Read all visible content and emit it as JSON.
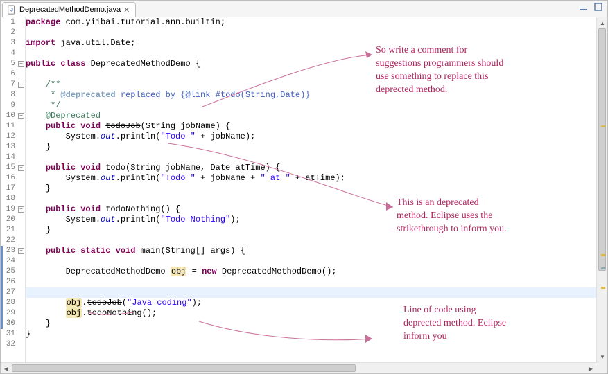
{
  "tab": {
    "filename": "DeprecatedMethodDemo.java",
    "close_glyph": "✕"
  },
  "code": {
    "highlight_line": 27,
    "lines": [
      {
        "n": 1,
        "fold": "",
        "mod": false,
        "tokens": [
          [
            "kw",
            "package"
          ],
          [
            "pkg",
            " com.yiibai.tutorial.ann.builtin;"
          ]
        ]
      },
      {
        "n": 2,
        "fold": "",
        "mod": false,
        "tokens": []
      },
      {
        "n": 3,
        "fold": "",
        "mod": false,
        "tokens": [
          [
            "kw",
            "import"
          ],
          [
            "pkg",
            " java.util.Date;"
          ]
        ]
      },
      {
        "n": 4,
        "fold": "",
        "mod": false,
        "tokens": []
      },
      {
        "n": 5,
        "fold": "-",
        "mod": false,
        "tokens": [
          [
            "kw",
            "public class"
          ],
          [
            "pkg",
            " DeprecatedMethodDemo {"
          ]
        ]
      },
      {
        "n": 6,
        "fold": "",
        "mod": false,
        "tokens": []
      },
      {
        "n": 7,
        "fold": "-",
        "mod": false,
        "tokens": [
          [
            "pkg",
            "    "
          ],
          [
            "com",
            "/**"
          ]
        ]
      },
      {
        "n": 8,
        "fold": "",
        "mod": false,
        "tokens": [
          [
            "pkg",
            "    "
          ],
          [
            "com",
            " * "
          ],
          [
            "jtag",
            "@deprecated"
          ],
          [
            "jlink",
            " replaced by {@link #todo(String,Date)}"
          ]
        ]
      },
      {
        "n": 9,
        "fold": "",
        "mod": false,
        "tokens": [
          [
            "pkg",
            "    "
          ],
          [
            "com",
            " */"
          ]
        ]
      },
      {
        "n": 10,
        "fold": "-",
        "mod": false,
        "tokens": [
          [
            "pkg",
            "    "
          ],
          [
            "com",
            "@Deprecated"
          ]
        ]
      },
      {
        "n": 11,
        "fold": "",
        "mod": false,
        "tokens": [
          [
            "pkg",
            "    "
          ],
          [
            "kw",
            "public void"
          ],
          [
            "pkg",
            " "
          ],
          [
            "strike",
            "todoJob"
          ],
          [
            "pkg",
            "(String jobName) {"
          ]
        ]
      },
      {
        "n": 12,
        "fold": "",
        "mod": false,
        "tokens": [
          [
            "pkg",
            "        System."
          ],
          [
            "fld",
            "out"
          ],
          [
            "pkg",
            ".println("
          ],
          [
            "str",
            "\"Todo \""
          ],
          [
            "pkg",
            " + jobName);"
          ]
        ]
      },
      {
        "n": 13,
        "fold": "",
        "mod": false,
        "tokens": [
          [
            "pkg",
            "    }"
          ]
        ]
      },
      {
        "n": 14,
        "fold": "",
        "mod": false,
        "tokens": []
      },
      {
        "n": 15,
        "fold": "-",
        "mod": false,
        "tokens": [
          [
            "pkg",
            "    "
          ],
          [
            "kw",
            "public void"
          ],
          [
            "pkg",
            " todo(String jobName, Date atTime) {"
          ]
        ]
      },
      {
        "n": 16,
        "fold": "",
        "mod": false,
        "tokens": [
          [
            "pkg",
            "        System."
          ],
          [
            "fld",
            "out"
          ],
          [
            "pkg",
            ".println("
          ],
          [
            "str",
            "\"Todo \""
          ],
          [
            "pkg",
            " + jobName + "
          ],
          [
            "str",
            "\" at \""
          ],
          [
            "pkg",
            " + atTime);"
          ]
        ]
      },
      {
        "n": 17,
        "fold": "",
        "mod": false,
        "tokens": [
          [
            "pkg",
            "    }"
          ]
        ]
      },
      {
        "n": 18,
        "fold": "",
        "mod": false,
        "tokens": []
      },
      {
        "n": 19,
        "fold": "-",
        "mod": false,
        "tokens": [
          [
            "pkg",
            "    "
          ],
          [
            "kw",
            "public void"
          ],
          [
            "pkg",
            " todoNothing() {"
          ]
        ]
      },
      {
        "n": 20,
        "fold": "",
        "mod": false,
        "tokens": [
          [
            "pkg",
            "        System."
          ],
          [
            "fld",
            "out"
          ],
          [
            "pkg",
            ".println("
          ],
          [
            "str",
            "\"Todo Nothing\""
          ],
          [
            "pkg",
            ");"
          ]
        ]
      },
      {
        "n": 21,
        "fold": "",
        "mod": false,
        "tokens": [
          [
            "pkg",
            "    }"
          ]
        ]
      },
      {
        "n": 22,
        "fold": "",
        "mod": false,
        "tokens": []
      },
      {
        "n": 23,
        "fold": "-",
        "mod": true,
        "tokens": [
          [
            "pkg",
            "    "
          ],
          [
            "kw",
            "public static void"
          ],
          [
            "pkg",
            " main(String[] args) {"
          ]
        ]
      },
      {
        "n": 24,
        "fold": "",
        "mod": true,
        "tokens": []
      },
      {
        "n": 25,
        "fold": "",
        "mod": true,
        "tokens": [
          [
            "pkg",
            "        DeprecatedMethodDemo "
          ],
          [
            "warn",
            "obj"
          ],
          [
            "pkg",
            " = "
          ],
          [
            "kw",
            "new"
          ],
          [
            "pkg",
            " DeprecatedMethodDemo();"
          ]
        ]
      },
      {
        "n": 26,
        "fold": "",
        "mod": true,
        "tokens": []
      },
      {
        "n": 27,
        "fold": "",
        "mod": true,
        "tokens": [
          [
            "pkg",
            "        "
          ],
          [
            "warn",
            "obj"
          ],
          [
            "pkg",
            "."
          ],
          [
            "strike underline",
            "todoJob"
          ],
          [
            "pkg",
            "("
          ],
          [
            "str",
            "\"Java coding\""
          ],
          [
            "pkg",
            ");"
          ]
        ]
      },
      {
        "n": 28,
        "fold": "",
        "mod": true,
        "tokens": []
      },
      {
        "n": 29,
        "fold": "",
        "mod": true,
        "tokens": [
          [
            "pkg",
            "        "
          ],
          [
            "warn",
            "obj"
          ],
          [
            "pkg",
            ".todoNothing();"
          ]
        ]
      },
      {
        "n": 30,
        "fold": "",
        "mod": true,
        "tokens": [
          [
            "pkg",
            "    }"
          ]
        ]
      },
      {
        "n": 31,
        "fold": "",
        "mod": false,
        "tokens": [
          [
            "pkg",
            "}"
          ]
        ]
      },
      {
        "n": 32,
        "fold": "",
        "mod": false,
        "tokens": []
      }
    ]
  },
  "annotations": {
    "a1": "So write a comment for\nsuggestions programmers should\nuse something to replace this\ndeprected method.",
    "a2": "This is an deprecated\nmethod. Eclipse uses the\nstrikethrough to inform you.",
    "a3": "Line of code using\ndeprected method. Eclipse\ninform you"
  },
  "overview_marks": [
    {
      "top_pct": 30,
      "color": "#dcb94a"
    },
    {
      "top_pct": 70,
      "color": "#dcb94a"
    },
    {
      "top_pct": 74,
      "color": "#8fa8b5"
    },
    {
      "top_pct": 80,
      "color": "#dcb94a"
    }
  ]
}
